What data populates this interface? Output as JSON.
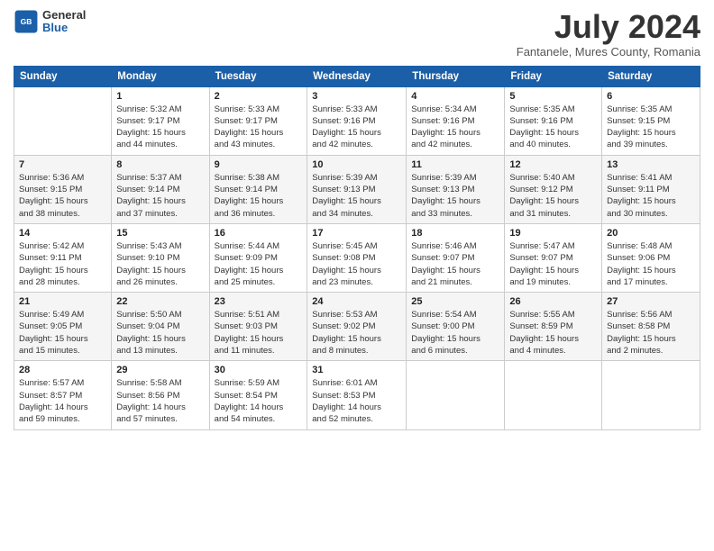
{
  "header": {
    "logo": {
      "general": "General",
      "blue": "Blue"
    },
    "title": "July 2024",
    "subtitle": "Fantanele, Mures County, Romania"
  },
  "calendar": {
    "days_of_week": [
      "Sunday",
      "Monday",
      "Tuesday",
      "Wednesday",
      "Thursday",
      "Friday",
      "Saturday"
    ],
    "weeks": [
      [
        {
          "day": "",
          "info": ""
        },
        {
          "day": "1",
          "info": "Sunrise: 5:32 AM\nSunset: 9:17 PM\nDaylight: 15 hours\nand 44 minutes."
        },
        {
          "day": "2",
          "info": "Sunrise: 5:33 AM\nSunset: 9:17 PM\nDaylight: 15 hours\nand 43 minutes."
        },
        {
          "day": "3",
          "info": "Sunrise: 5:33 AM\nSunset: 9:16 PM\nDaylight: 15 hours\nand 42 minutes."
        },
        {
          "day": "4",
          "info": "Sunrise: 5:34 AM\nSunset: 9:16 PM\nDaylight: 15 hours\nand 42 minutes."
        },
        {
          "day": "5",
          "info": "Sunrise: 5:35 AM\nSunset: 9:16 PM\nDaylight: 15 hours\nand 40 minutes."
        },
        {
          "day": "6",
          "info": "Sunrise: 5:35 AM\nSunset: 9:15 PM\nDaylight: 15 hours\nand 39 minutes."
        }
      ],
      [
        {
          "day": "7",
          "info": "Sunrise: 5:36 AM\nSunset: 9:15 PM\nDaylight: 15 hours\nand 38 minutes."
        },
        {
          "day": "8",
          "info": "Sunrise: 5:37 AM\nSunset: 9:14 PM\nDaylight: 15 hours\nand 37 minutes."
        },
        {
          "day": "9",
          "info": "Sunrise: 5:38 AM\nSunset: 9:14 PM\nDaylight: 15 hours\nand 36 minutes."
        },
        {
          "day": "10",
          "info": "Sunrise: 5:39 AM\nSunset: 9:13 PM\nDaylight: 15 hours\nand 34 minutes."
        },
        {
          "day": "11",
          "info": "Sunrise: 5:39 AM\nSunset: 9:13 PM\nDaylight: 15 hours\nand 33 minutes."
        },
        {
          "day": "12",
          "info": "Sunrise: 5:40 AM\nSunset: 9:12 PM\nDaylight: 15 hours\nand 31 minutes."
        },
        {
          "day": "13",
          "info": "Sunrise: 5:41 AM\nSunset: 9:11 PM\nDaylight: 15 hours\nand 30 minutes."
        }
      ],
      [
        {
          "day": "14",
          "info": "Sunrise: 5:42 AM\nSunset: 9:11 PM\nDaylight: 15 hours\nand 28 minutes."
        },
        {
          "day": "15",
          "info": "Sunrise: 5:43 AM\nSunset: 9:10 PM\nDaylight: 15 hours\nand 26 minutes."
        },
        {
          "day": "16",
          "info": "Sunrise: 5:44 AM\nSunset: 9:09 PM\nDaylight: 15 hours\nand 25 minutes."
        },
        {
          "day": "17",
          "info": "Sunrise: 5:45 AM\nSunset: 9:08 PM\nDaylight: 15 hours\nand 23 minutes."
        },
        {
          "day": "18",
          "info": "Sunrise: 5:46 AM\nSunset: 9:07 PM\nDaylight: 15 hours\nand 21 minutes."
        },
        {
          "day": "19",
          "info": "Sunrise: 5:47 AM\nSunset: 9:07 PM\nDaylight: 15 hours\nand 19 minutes."
        },
        {
          "day": "20",
          "info": "Sunrise: 5:48 AM\nSunset: 9:06 PM\nDaylight: 15 hours\nand 17 minutes."
        }
      ],
      [
        {
          "day": "21",
          "info": "Sunrise: 5:49 AM\nSunset: 9:05 PM\nDaylight: 15 hours\nand 15 minutes."
        },
        {
          "day": "22",
          "info": "Sunrise: 5:50 AM\nSunset: 9:04 PM\nDaylight: 15 hours\nand 13 minutes."
        },
        {
          "day": "23",
          "info": "Sunrise: 5:51 AM\nSunset: 9:03 PM\nDaylight: 15 hours\nand 11 minutes."
        },
        {
          "day": "24",
          "info": "Sunrise: 5:53 AM\nSunset: 9:02 PM\nDaylight: 15 hours\nand 8 minutes."
        },
        {
          "day": "25",
          "info": "Sunrise: 5:54 AM\nSunset: 9:00 PM\nDaylight: 15 hours\nand 6 minutes."
        },
        {
          "day": "26",
          "info": "Sunrise: 5:55 AM\nSunset: 8:59 PM\nDaylight: 15 hours\nand 4 minutes."
        },
        {
          "day": "27",
          "info": "Sunrise: 5:56 AM\nSunset: 8:58 PM\nDaylight: 15 hours\nand 2 minutes."
        }
      ],
      [
        {
          "day": "28",
          "info": "Sunrise: 5:57 AM\nSunset: 8:57 PM\nDaylight: 14 hours\nand 59 minutes."
        },
        {
          "day": "29",
          "info": "Sunrise: 5:58 AM\nSunset: 8:56 PM\nDaylight: 14 hours\nand 57 minutes."
        },
        {
          "day": "30",
          "info": "Sunrise: 5:59 AM\nSunset: 8:54 PM\nDaylight: 14 hours\nand 54 minutes."
        },
        {
          "day": "31",
          "info": "Sunrise: 6:01 AM\nSunset: 8:53 PM\nDaylight: 14 hours\nand 52 minutes."
        },
        {
          "day": "",
          "info": ""
        },
        {
          "day": "",
          "info": ""
        },
        {
          "day": "",
          "info": ""
        }
      ]
    ]
  }
}
